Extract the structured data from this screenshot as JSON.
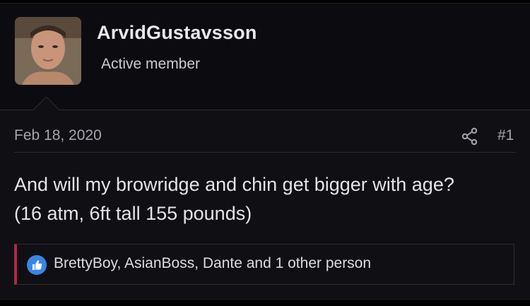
{
  "post": {
    "author": {
      "username": "ArvidGustavsson",
      "title": "Active member",
      "avatar_icon": "user-avatar-photo"
    },
    "date": "Feb 18, 2020",
    "share_icon": "share-icon",
    "post_number": "#1",
    "message_lines": [
      "And will my browridge and chin get bigger with age?",
      "(16 atm, 6ft tall 155 pounds)"
    ],
    "reactions": {
      "icon": "like-icon",
      "text": "BrettyBoy, AsianBoss, Dante and 1 other person",
      "accent_color": "#b0284a"
    }
  }
}
